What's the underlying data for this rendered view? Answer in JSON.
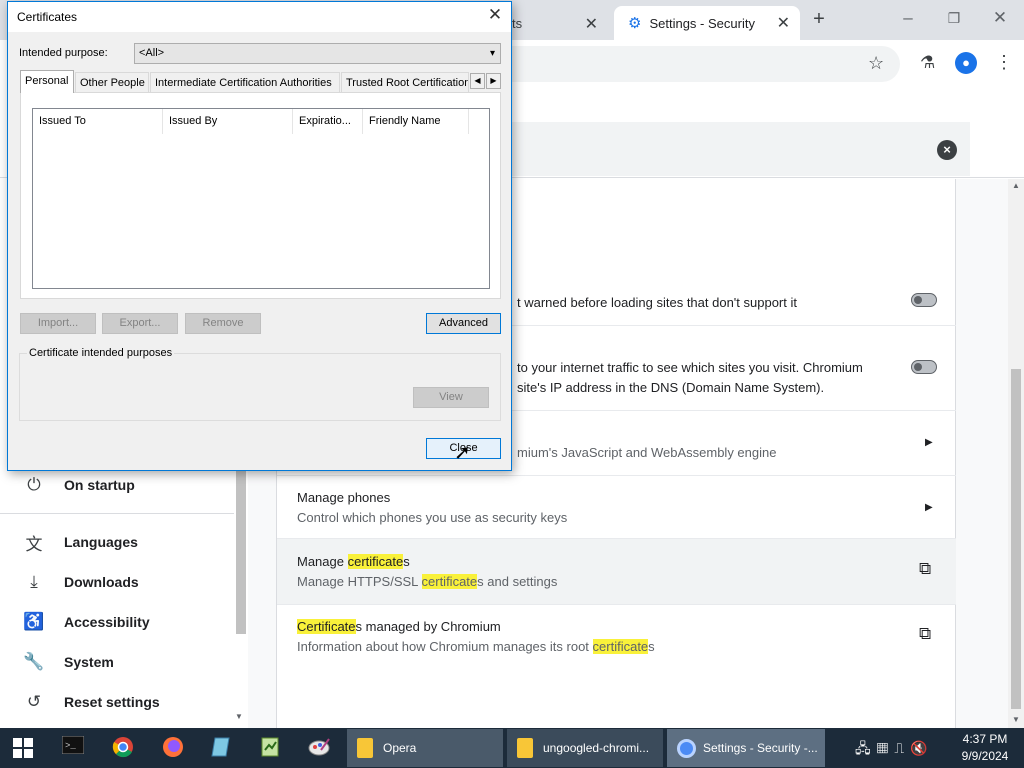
{
  "browser": {
    "inactive_tab_label": "ts",
    "active_tab_label": "Settings - Security",
    "new_tab_symbol": "+",
    "close_symbol": "✕"
  },
  "sidebar": {
    "items": [
      {
        "label": "On startup",
        "icon": "power-icon"
      },
      {
        "label": "Languages",
        "icon": "translate-icon"
      },
      {
        "label": "Downloads",
        "icon": "download-icon"
      },
      {
        "label": "Accessibility",
        "icon": "accessibility-icon"
      },
      {
        "label": "System",
        "icon": "wrench-icon"
      },
      {
        "label": "Reset settings",
        "icon": "reset-icon"
      }
    ]
  },
  "settings_rows": {
    "https_desc": "t warned before loading sites that don't support it",
    "dns_desc_1": "to your internet traffic to see which sites you visit. Chromium",
    "dns_desc_2": "site's IP address in the DNS (Domain Name System).",
    "v8_desc": "mium's JavaScript and WebAssembly engine",
    "phones_title": "Manage phones",
    "phones_desc": "Control which phones you use as security keys",
    "certs_title_a": "Manage ",
    "certs_title_hl": "certificate",
    "certs_title_b": "s",
    "certs_desc_a": "Manage HTTPS/SSL ",
    "certs_desc_hl": "certificate",
    "certs_desc_b": "s and settings",
    "chromium_title_hl": "Certificate",
    "chromium_title_b": "s managed by Chromium",
    "chromium_desc_a": "Information about how Chromium manages its root ",
    "chromium_desc_hl": "certificate",
    "chromium_desc_b": "s"
  },
  "dialog": {
    "title": "Certificates",
    "purpose_label": "Intended purpose:",
    "purpose_value": "<All>",
    "tabs": [
      "Personal",
      "Other People",
      "Intermediate Certification Authorities",
      "Trusted Root Certification"
    ],
    "columns": [
      "Issued To",
      "Issued By",
      "Expiratio...",
      "Friendly Name"
    ],
    "buttons": {
      "import": "Import...",
      "export": "Export...",
      "remove": "Remove",
      "advanced": "Advanced",
      "view": "View",
      "close": "Close"
    },
    "purposes_group_label": "Certificate intended purposes"
  },
  "taskbar": {
    "tasks": [
      "Opera",
      "ungoogled-chromi...",
      "Settings - Security -..."
    ],
    "time": "4:37 PM",
    "date": "9/9/2024"
  },
  "colors": {
    "highlight": "#f9f13a",
    "accent": "#1a73e8",
    "dialog_border": "#0078d7"
  }
}
